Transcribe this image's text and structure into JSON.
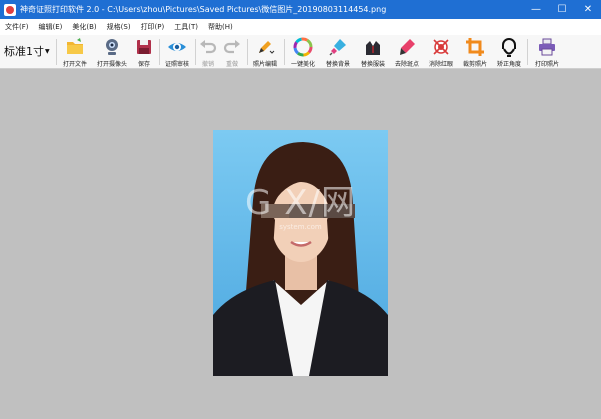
{
  "window": {
    "title": "神奇证照打印软件 2.0 - C:\\Users\\zhou\\Pictures\\Saved Pictures\\微信图片_20190803114454.png",
    "minimize": "—",
    "maximize": "☐",
    "close": "✕"
  },
  "menu": [
    "文件(F)",
    "编辑(E)",
    "美化(B)",
    "规格(S)",
    "打印(P)",
    "工具(T)",
    "帮助(H)"
  ],
  "toolbar": {
    "size_select": "标准1寸",
    "tools": [
      {
        "label": "打开文件",
        "icon": "folder-icon",
        "enabled": true
      },
      {
        "label": "打开摄像头",
        "icon": "webcam-icon",
        "enabled": true
      },
      {
        "label": "保存",
        "icon": "save-icon",
        "enabled": true
      },
      {
        "label": "证照审核",
        "icon": "eye-icon",
        "enabled": true
      },
      {
        "label": "撤销",
        "icon": "undo-icon",
        "enabled": false
      },
      {
        "label": "重做",
        "icon": "redo-icon",
        "enabled": false
      },
      {
        "label": "照片编辑",
        "icon": "pencil-icon",
        "enabled": true
      },
      {
        "label": "一键美化",
        "icon": "color-wheel-icon",
        "enabled": true
      },
      {
        "label": "替换背景",
        "icon": "brush-icon",
        "enabled": true
      },
      {
        "label": "替换服装",
        "icon": "suit-icon",
        "enabled": true
      },
      {
        "label": "去除斑点",
        "icon": "pen-icon",
        "enabled": true
      },
      {
        "label": "消除红眼",
        "icon": "red-eye-icon",
        "enabled": true
      },
      {
        "label": "裁剪照片",
        "icon": "crop-icon",
        "enabled": true
      },
      {
        "label": "矫正角度",
        "icon": "head-outline-icon",
        "enabled": true
      },
      {
        "label": "打印照片",
        "icon": "printer-icon",
        "enabled": true
      }
    ]
  },
  "watermark": {
    "text": "G X/网",
    "sub": "system.com"
  },
  "colors": {
    "titlebar": "#1f6fd3",
    "canvas": "#c0c0c0",
    "photo_background": "#5ab4e8"
  }
}
